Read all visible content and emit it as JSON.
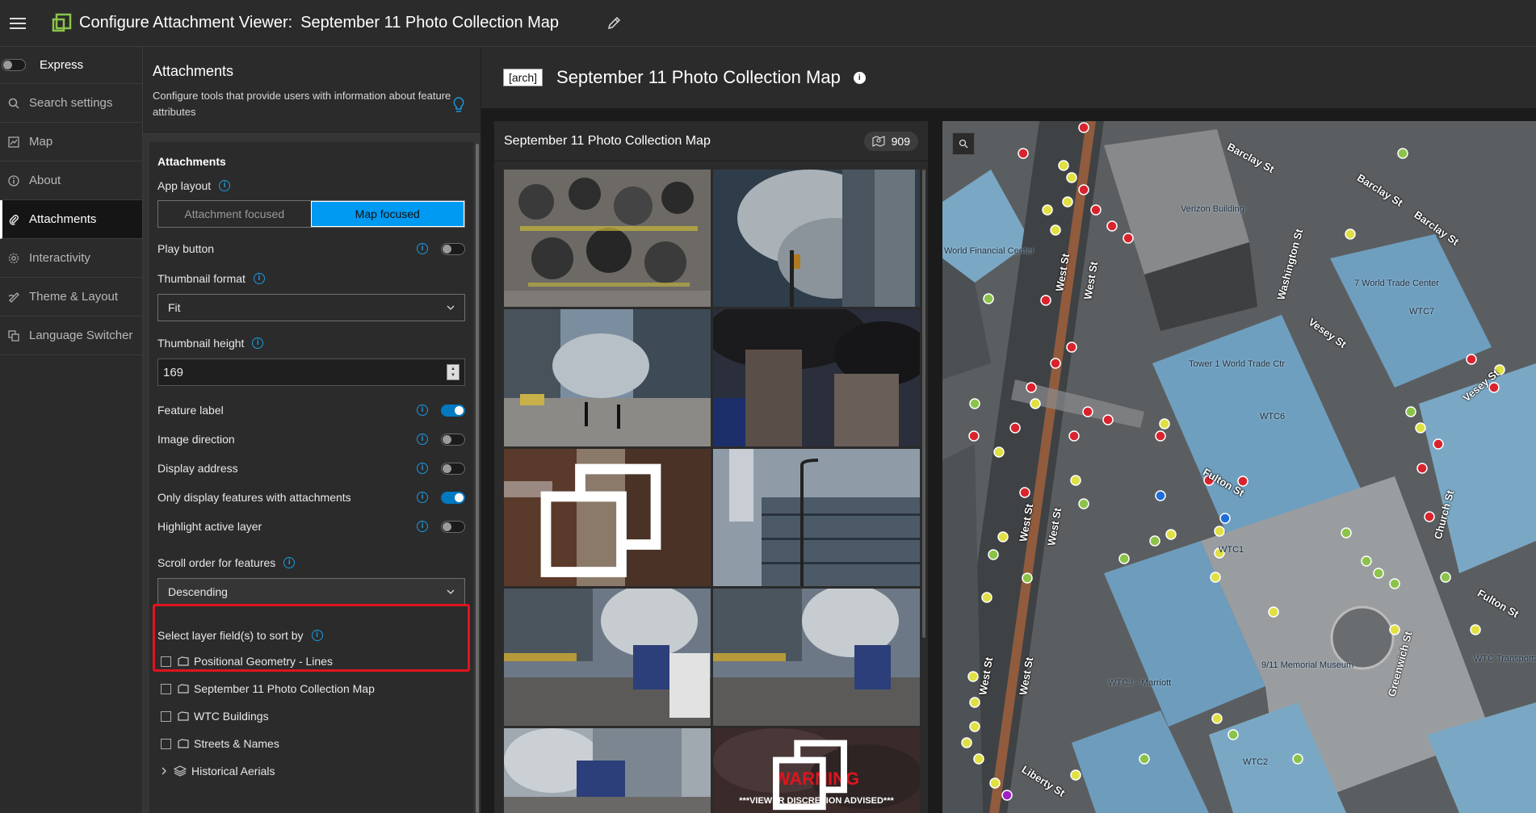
{
  "header": {
    "app_title": "Configure Attachment Viewer:",
    "map_title": "September 11 Photo Collection Map"
  },
  "nav": {
    "express_label": "Express",
    "items": [
      {
        "label": "Search settings",
        "icon": "search-icon"
      },
      {
        "label": "Map",
        "icon": "map-icon"
      },
      {
        "label": "About",
        "icon": "info-icon"
      },
      {
        "label": "Attachments",
        "icon": "paperclip-icon",
        "active": true
      },
      {
        "label": "Interactivity",
        "icon": "gear-icon"
      },
      {
        "label": "Theme & Layout",
        "icon": "palette-icon"
      },
      {
        "label": "Language Switcher",
        "icon": "language-icon"
      }
    ]
  },
  "settings": {
    "title": "Attachments",
    "description": "Configure tools that provide users with information about feature attributes",
    "panel_title": "Attachments",
    "app_layout": {
      "label": "App layout",
      "options": [
        "Attachment focused",
        "Map focused"
      ],
      "selected": "Map focused"
    },
    "play_button": {
      "label": "Play button",
      "on": false
    },
    "thumbnail_format": {
      "label": "Thumbnail format",
      "value": "Fit"
    },
    "thumbnail_height": {
      "label": "Thumbnail height",
      "value": "169"
    },
    "feature_label": {
      "label": "Feature label",
      "on": true
    },
    "image_direction": {
      "label": "Image direction",
      "on": false
    },
    "display_address": {
      "label": "Display address",
      "on": false
    },
    "only_display": {
      "label": "Only display features with attachments",
      "on": true
    },
    "highlight_layer": {
      "label": "Highlight active layer",
      "on": false
    },
    "scroll_order": {
      "label": "Scroll order for features",
      "value": "Descending"
    },
    "sort_fields": {
      "label": "Select layer field(s) to sort by",
      "layers": [
        "Positional Geometry - Lines",
        "September 11 Photo Collection Map",
        "WTC Buildings",
        "Streets & Names"
      ],
      "group": "Historical Aerials"
    }
  },
  "main": {
    "badge": "[arch]",
    "title": "September 11 Photo Collection Map",
    "gallery_title": "September 11 Photo Collection Map",
    "count": "909",
    "warning_title": "WARNING",
    "warning_sub": "***VIEWER DISCRETION ADVISED***"
  },
  "map": {
    "streets": [
      "Barclay St",
      "Barclay St",
      "Barclay St",
      "West St",
      "West St",
      "Washington St",
      "Vesey St",
      "Vesey St",
      "Fulton St",
      "Fulton St",
      "West St",
      "West St",
      "West St",
      "West St",
      "Greenwich St",
      "Liberty St",
      "Church St"
    ],
    "buildings": [
      "World Financial Center",
      "Verizon Building",
      "7 World Trade Center",
      "WTC7",
      "Tower 1 World Trade Ctr",
      "WTC6",
      "WTC1",
      "9/11 Memorial Museum",
      "WTC3 - Marriott",
      "WTC2",
      "WTC Transportation Hub"
    ]
  },
  "colors": {
    "accent": "#009af2",
    "highlight": "#e0141e"
  }
}
